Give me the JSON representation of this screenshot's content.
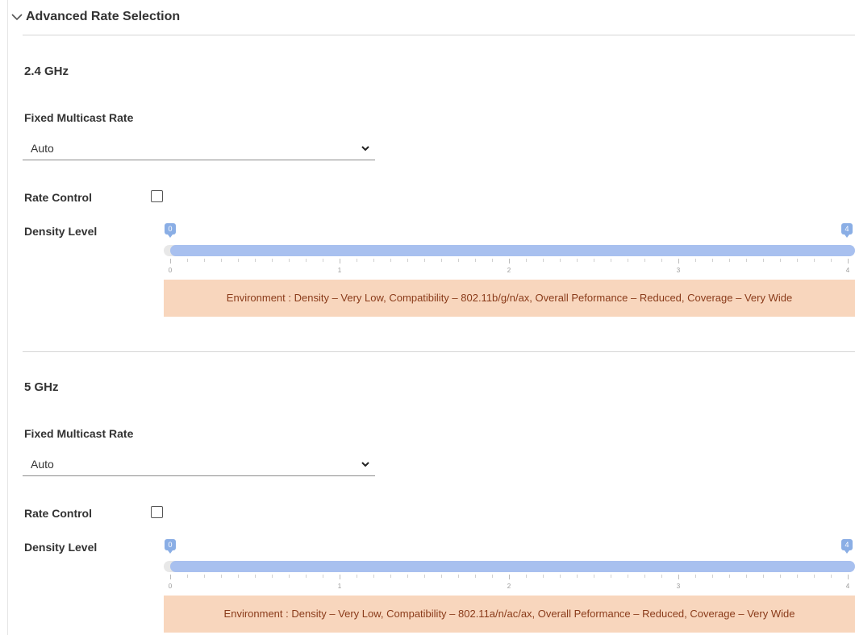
{
  "header": {
    "title": "Advanced Rate Selection",
    "icon": "chevron-down-icon"
  },
  "bands": [
    {
      "title": "2.4 GHz",
      "multicast": {
        "label": "Fixed Multicast Rate",
        "value": "Auto"
      },
      "rate_control": {
        "label": "Rate Control",
        "checked": false
      },
      "density": {
        "label": "Density Level",
        "min": 0,
        "max": 4,
        "low_handle": "0",
        "high_handle": "4",
        "tick_labels": [
          "0",
          "1",
          "2",
          "3",
          "4"
        ]
      },
      "environment": "Environment : Density – Very Low, Compatibility – 802.11b/g/n/ax, Overall Peformance – Reduced, Coverage – Very Wide"
    },
    {
      "title": "5 GHz",
      "multicast": {
        "label": "Fixed Multicast Rate",
        "value": "Auto"
      },
      "rate_control": {
        "label": "Rate Control",
        "checked": false
      },
      "density": {
        "label": "Density Level",
        "min": 0,
        "max": 4,
        "low_handle": "0",
        "high_handle": "4",
        "tick_labels": [
          "0",
          "1",
          "2",
          "3",
          "4"
        ]
      },
      "environment": "Environment : Density – Very Low, Compatibility – 802.11a/n/ac/ax, Overall Peformance – Reduced, Coverage – Very Wide"
    }
  ],
  "colors": {
    "slider_fill": "#a8c0ef",
    "slider_handle": "#8aaee5",
    "env_background": "#f8d6bd",
    "env_text": "#8a3b1a"
  }
}
